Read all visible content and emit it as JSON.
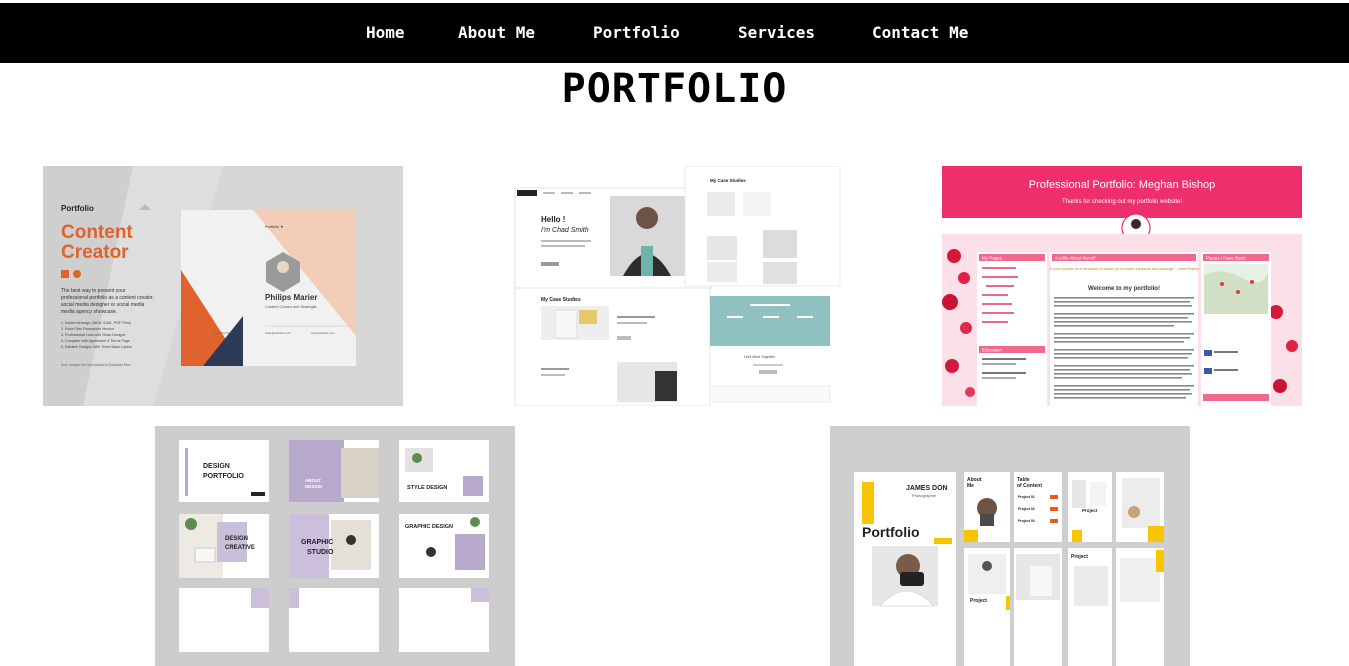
{
  "nav": {
    "items": [
      "Home",
      "About Me",
      "Portfolio",
      "Services",
      "Contact Me"
    ]
  },
  "page": {
    "title": "PORTFOLIO"
  },
  "cards": {
    "c1": {
      "brand": "Portfolio",
      "heading1": "Content",
      "heading2": "Creator",
      "name": "Philips Marier",
      "role": "Content Creator and Strategist",
      "blurb": [
        "The best way to present your",
        "professional portfolio as a content creator,",
        "social media designer or social media",
        "media agency showcase."
      ],
      "features": [
        "1. Adobe InDesign (INDD, IDML, PDF Files)",
        "2. Extra Files Powerpoint Version",
        "3. Professional Look with Clean Designs",
        "4. Complete with Agreement & Terms Page",
        "5. Editable Designs With Three Basic Layers"
      ],
      "footnote": "Note: Images Are Not Included in Download Files"
    },
    "c2": {
      "hello": "Hello !",
      "iam": "I'm Chad Smith",
      "case": "My Case Studies",
      "brand": "Portfolio",
      "together": "Let's Work Together"
    },
    "c3": {
      "title": "Professional Portfolio: Meghan Bishop",
      "subtitle": "Thanks for checking out my portfolio website!",
      "welcome": "Welcome to my portfolio!",
      "mypages": "My Pages",
      "education": "Education",
      "about": "A Little About Myself",
      "map": "Places I Have Been",
      "quote": "\"It is the supreme art of the teacher to awaken joy in creative expression and knowledge.\" - Albert Einstein"
    },
    "c4": {
      "t1": "DESIGN",
      "t1b": "PORTFOLIO",
      "t2": "ABOUT",
      "t2b": "DESIGN",
      "t3": "STYLE DESIGN",
      "t4": "DESIGN",
      "t4b": "CREATIVE",
      "t5": "GRAPHIC",
      "t5b": "STUDIO",
      "t6": "GRAPHIC DESIGN"
    },
    "c5": {
      "name": "JAMES DON",
      "role": "Photographer",
      "word": "Portfolio",
      "about": "About",
      "about2": "Me",
      "toc": "Table",
      "toc2": "of Content",
      "p1": "Project 01",
      "p2": "Project 02",
      "p3": "Project 03",
      "p4": "Project",
      "p5": "Project",
      "p6": "Project"
    }
  },
  "colors": {
    "orange": "#e0622c",
    "pink": "#ee2f6b",
    "yellow": "#f7c600",
    "teal": "#8fc1c0"
  }
}
